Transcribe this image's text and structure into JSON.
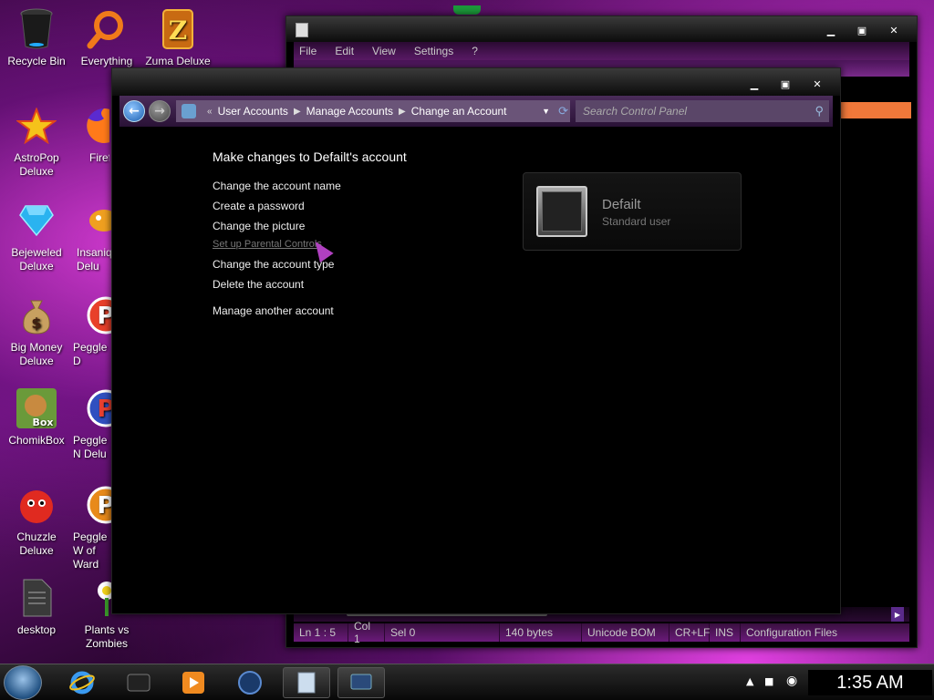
{
  "desktop_icons": [
    {
      "label": "Recycle Bin",
      "icon": "recycle-bin-icon"
    },
    {
      "label": "Everything",
      "icon": "search-magnifier-icon"
    },
    {
      "label": "Zuma Deluxe",
      "icon": "zuma-icon"
    },
    {
      "label": "AstroPop Deluxe",
      "icon": "astropop-icon"
    },
    {
      "label": "Firef",
      "icon": "firefox-icon"
    },
    {
      "label": "Bejeweled Deluxe",
      "icon": "gem-icon"
    },
    {
      "label": "Insaniq Delu",
      "icon": "insaniquarium-icon"
    },
    {
      "label": "Big Money Deluxe",
      "icon": "money-bag-icon"
    },
    {
      "label": "Peggle D",
      "icon": "peggle-icon"
    },
    {
      "label": "ChomikBox",
      "icon": "chomikbox-icon"
    },
    {
      "label": "Peggle N Delu",
      "icon": "peggle-nights-icon"
    },
    {
      "label": "Chuzzle Deluxe",
      "icon": "chuzzle-icon"
    },
    {
      "label": "Peggle W of Ward",
      "icon": "peggle-world-icon"
    },
    {
      "label": "desktop",
      "icon": "file-icon"
    },
    {
      "label": "Plants vs Zombies",
      "icon": "plants-vs-zombies-icon"
    }
  ],
  "bg_window": {
    "menu": [
      "File",
      "Edit",
      "View",
      "Settings",
      "?"
    ],
    "status": {
      "position": "Ln 1 : 5",
      "col": "Col 1",
      "sel": "Sel 0",
      "size": "140 bytes",
      "encoding": "Unicode BOM",
      "line_ending": "CR+LF",
      "mode": "INS",
      "scheme": "Configuration Files"
    }
  },
  "cp_window": {
    "breadcrumb": [
      "User Accounts",
      "Manage Accounts",
      "Change an Account"
    ],
    "search_placeholder": "Search Control Panel",
    "heading": "Make changes to Defailt's account",
    "tasks": [
      "Change the account name",
      "Create a password",
      "Change the picture",
      "Set up Parental Controls",
      "Change the account type",
      "Delete the account",
      "Manage another account"
    ],
    "account": {
      "name": "Defailt",
      "type": "Standard user"
    }
  },
  "taskbar": {
    "clock": "1:35 AM"
  }
}
